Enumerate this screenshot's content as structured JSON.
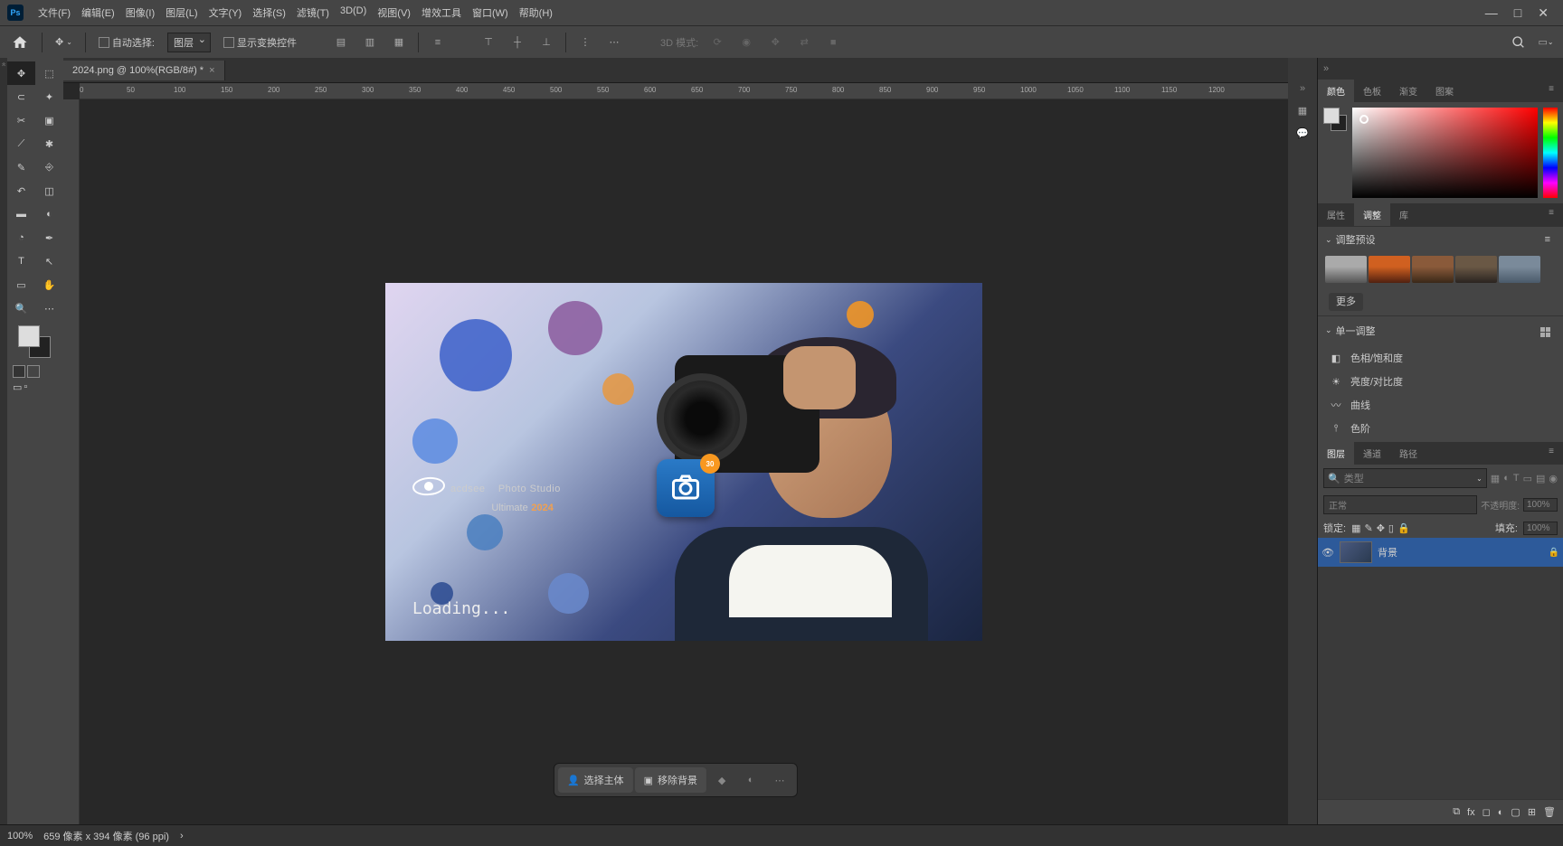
{
  "menubar": {
    "items": [
      "文件(F)",
      "编辑(E)",
      "图像(I)",
      "图层(L)",
      "文字(Y)",
      "选择(S)",
      "滤镜(T)",
      "3D(D)",
      "视图(V)",
      "增效工具",
      "窗口(W)",
      "帮助(H)"
    ]
  },
  "toolbar": {
    "autoSelect": "自动选择:",
    "layerDD": "图层",
    "showTransform": "显示变换控件",
    "mode3d": "3D 模式:"
  },
  "tab": {
    "title": "2024.png @ 100%(RGB/8#) *"
  },
  "ruler": {
    "ticks": [
      "0",
      "50",
      "100",
      "150",
      "200",
      "250",
      "300",
      "350",
      "400",
      "450",
      "500",
      "550",
      "600",
      "650",
      "700",
      "750",
      "800",
      "850",
      "900",
      "950",
      "1000",
      "1050",
      "1100",
      "1150",
      "1200"
    ]
  },
  "splash": {
    "brand": "acdsee",
    "product": "Photo Studio",
    "edition": "Ultimate",
    "year": "2024",
    "loading": "Loading...",
    "badge": "30"
  },
  "ctxbar": {
    "selectSubject": "选择主体",
    "removeBg": "移除背景"
  },
  "panels": {
    "colorTabs": [
      "颜色",
      "色板",
      "渐变",
      "图案"
    ],
    "propTabs": [
      "属性",
      "调整",
      "库"
    ],
    "adjPresets": "调整预设",
    "more": "更多",
    "singleAdj": "单一调整",
    "adjItems": [
      "色相/饱和度",
      "亮度/对比度",
      "曲线",
      "色阶"
    ],
    "layerTabs": [
      "图层",
      "通道",
      "路径"
    ],
    "typeSearch": "类型",
    "blendMode": "正常",
    "opacityLbl": "不透明度:",
    "opacityVal": "100%",
    "lockLbl": "锁定:",
    "fillLbl": "填充:",
    "fillVal": "100%",
    "bgLayerName": "背景"
  },
  "status": {
    "zoom": "100%",
    "info": "659 像素 x 394 像素 (96 ppi)"
  }
}
